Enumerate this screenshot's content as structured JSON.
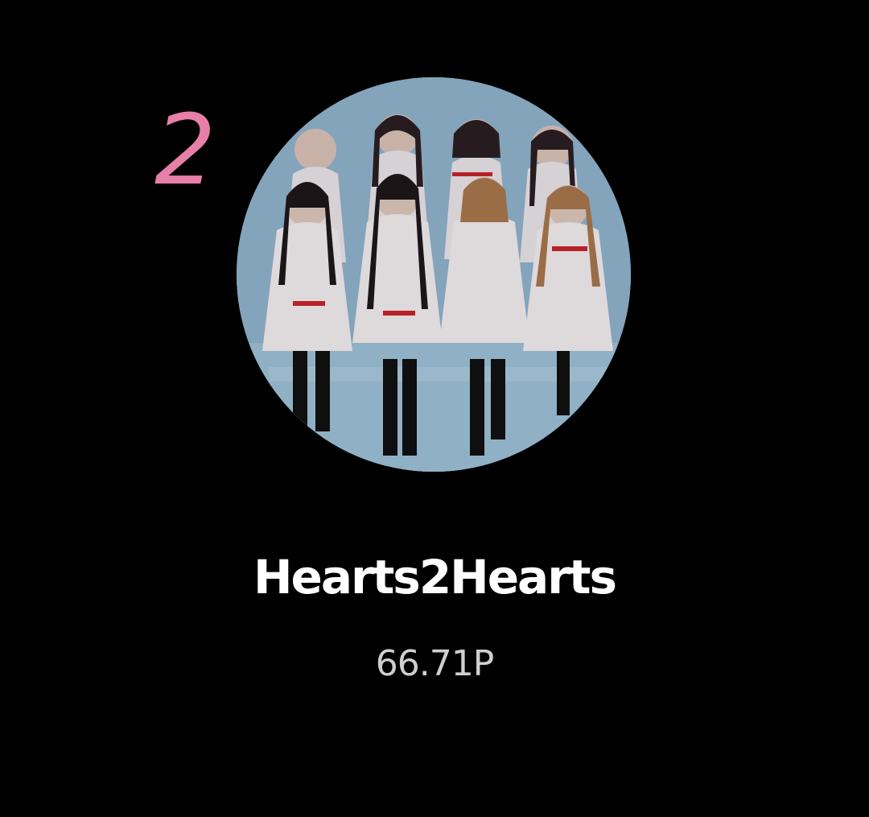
{
  "ranking_card": {
    "rank": "2",
    "group_name": "Hearts2Hearts",
    "points": "66.71P",
    "photo_icon": "group-photo",
    "colors": {
      "background": "#000000",
      "rank": "#e87fa9",
      "name": "#ffffff",
      "points": "#cfcfcf",
      "photo_backdrop": "#92b3cc"
    }
  }
}
